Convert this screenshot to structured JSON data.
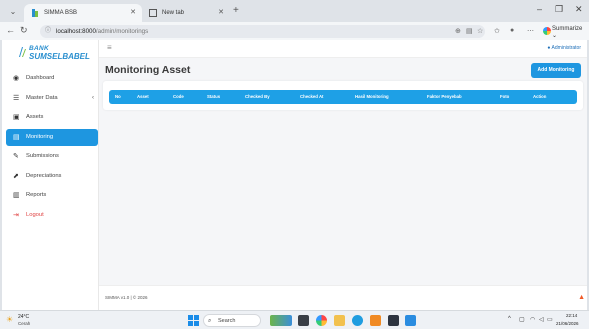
{
  "browser": {
    "tabs": [
      {
        "label": "SIMMA BSB",
        "active": true
      },
      {
        "label": "New tab",
        "active": false
      }
    ],
    "url_host": "localhost:8000",
    "url_path": "/admin/monitorings",
    "summarize_label": "Summarize"
  },
  "app": {
    "brand_line1": "BANK",
    "brand_line2": "SUMSELBABEL",
    "user_label": "Administrator",
    "sidebar": {
      "items": [
        {
          "label": "Dashboard",
          "icon": "dashboard-icon",
          "glyph": "◉"
        },
        {
          "label": "Master Data",
          "icon": "database-icon",
          "glyph": "☰"
        },
        {
          "label": "Assets",
          "icon": "assets-icon",
          "glyph": "▣"
        },
        {
          "label": "Monitoring",
          "icon": "monitoring-icon",
          "glyph": "▤"
        },
        {
          "label": "Submissions",
          "icon": "submissions-icon",
          "glyph": "✎"
        },
        {
          "label": "Depreciations",
          "icon": "chart-icon",
          "glyph": "⬈"
        },
        {
          "label": "Reports",
          "icon": "report-icon",
          "glyph": "▥"
        },
        {
          "label": "Logout",
          "icon": "logout-icon",
          "glyph": "⇥"
        }
      ]
    },
    "page_title": "Monitoring Asset",
    "add_button_label": "Add Monitoring",
    "table": {
      "columns": [
        "No",
        "Asset",
        "Code",
        "Status",
        "Checked By",
        "Checked At",
        "Hasil Monitoring",
        "Faktor Penyebab",
        "Foto",
        "Action"
      ]
    },
    "footer_text": "SIMMA v1.0 | © 2026"
  },
  "taskbar": {
    "weather_temp": "24°C",
    "weather_condition": "Cerah",
    "search_placeholder": "Search",
    "time": "22:14",
    "date": "21/06/2026"
  },
  "colors": {
    "accent": "#1e96e0",
    "table_header": "#1ea0e6",
    "logout": "#e04545"
  }
}
